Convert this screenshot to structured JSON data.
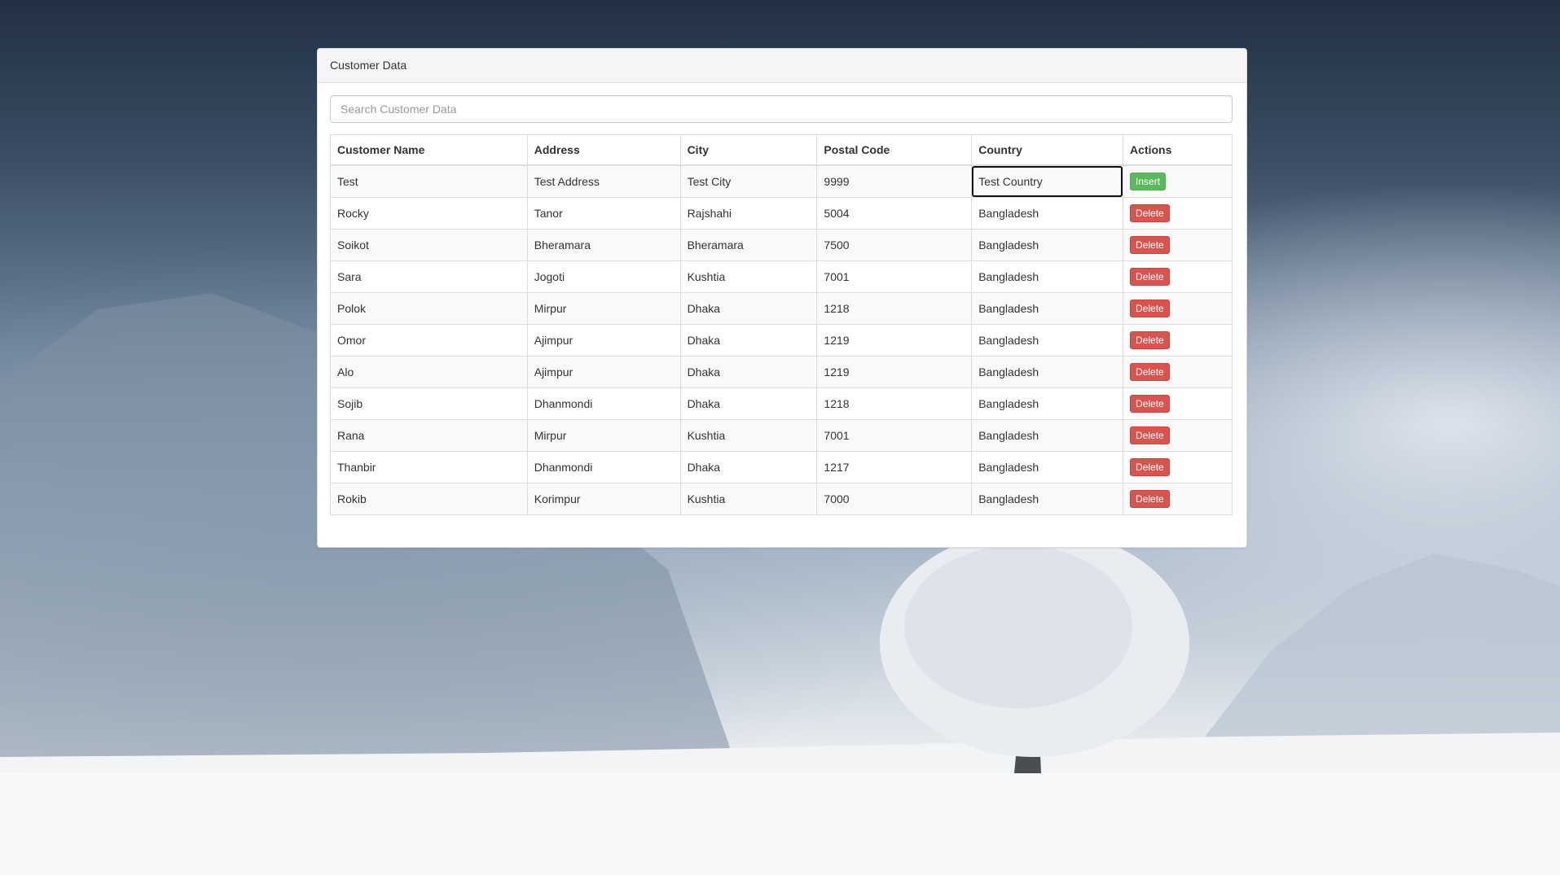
{
  "panel": {
    "title": "Customer Data"
  },
  "search": {
    "placeholder": "Search Customer Data"
  },
  "table": {
    "columns": [
      "Customer Name",
      "Address",
      "City",
      "Postal Code",
      "Country",
      "Actions"
    ],
    "input_row": {
      "name": "Test",
      "address": "Test Address",
      "city": "Test City",
      "postal": "9999",
      "country": "Test Country",
      "action": "Insert"
    },
    "rows": [
      {
        "name": "Rocky",
        "address": "Tanor",
        "city": "Rajshahi",
        "postal": "5004",
        "country": "Bangladesh",
        "action": "Delete"
      },
      {
        "name": "Soikot",
        "address": "Bheramara",
        "city": "Bheramara",
        "postal": "7500",
        "country": "Bangladesh",
        "action": "Delete"
      },
      {
        "name": "Sara",
        "address": "Jogoti",
        "city": "Kushtia",
        "postal": "7001",
        "country": "Bangladesh",
        "action": "Delete"
      },
      {
        "name": "Polok",
        "address": "Mirpur",
        "city": "Dhaka",
        "postal": "1218",
        "country": "Bangladesh",
        "action": "Delete"
      },
      {
        "name": "Omor",
        "address": "Ajimpur",
        "city": "Dhaka",
        "postal": "1219",
        "country": "Bangladesh",
        "action": "Delete"
      },
      {
        "name": "Alo",
        "address": "Ajimpur",
        "city": "Dhaka",
        "postal": "1219",
        "country": "Bangladesh",
        "action": "Delete"
      },
      {
        "name": "Sojib",
        "address": "Dhanmondi",
        "city": "Dhaka",
        "postal": "1218",
        "country": "Bangladesh",
        "action": "Delete"
      },
      {
        "name": "Rana",
        "address": "Mirpur",
        "city": "Kushtia",
        "postal": "7001",
        "country": "Bangladesh",
        "action": "Delete"
      },
      {
        "name": "Thanbir",
        "address": "Dhanmondi",
        "city": "Dhaka",
        "postal": "1217",
        "country": "Bangladesh",
        "action": "Delete"
      },
      {
        "name": "Rokib",
        "address": "Korimpur",
        "city": "Kushtia",
        "postal": "7000",
        "country": "Bangladesh",
        "action": "Delete"
      }
    ]
  },
  "colors": {
    "insert": "#5cb85c",
    "delete": "#d9534f",
    "panel_heading": "#f5f5f5"
  }
}
